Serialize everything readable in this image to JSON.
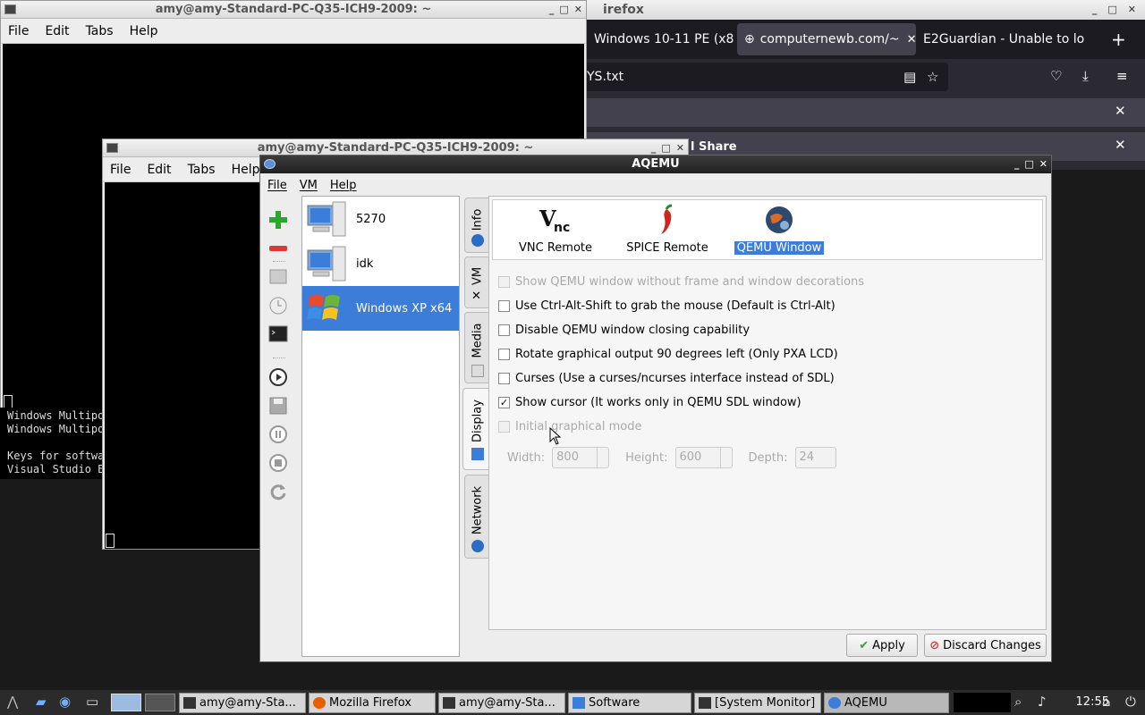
{
  "term1": {
    "title": "amy@amy-Standard-PC-Q35-ICH9-2009: ~",
    "menu": [
      "File",
      "Edit",
      "Tabs",
      "Help"
    ]
  },
  "bg_text": "Windows Multipo\nWindows Multipo\n\nKeys for softwa\nVisual Studio E",
  "firefox": {
    "title": "irefox",
    "tabs": [
      {
        "label": "Windows 10-11 PE (x8"
      },
      {
        "label": "computernewb.com/~"
      },
      {
        "label": "E2Guardian - Unable to lo"
      }
    ],
    "new_tab": "+",
    "url": "YS.txt",
    "share_label": "l Share"
  },
  "term2": {
    "title": "amy@amy-Standard-PC-Q35-ICH9-2009: ~",
    "menu": [
      "File",
      "Edit",
      "Tabs",
      "Help"
    ]
  },
  "aqemu": {
    "title": "AQEMU",
    "menu": [
      "File",
      "VM",
      "Help"
    ],
    "vms": [
      {
        "name": "5270"
      },
      {
        "name": "idk"
      },
      {
        "name": "Windows XP x64"
      }
    ],
    "tabs": [
      "Info",
      "VM",
      "Media",
      "Display",
      "Network"
    ],
    "modes": [
      "VNC Remote",
      "SPICE Remote",
      "QEMU Window"
    ],
    "options": [
      {
        "label": "Show QEMU window without frame and window decorations",
        "checked": false,
        "disabled": true
      },
      {
        "label": "Use Ctrl-Alt-Shift to grab the mouse (Default is Ctrl-Alt)",
        "checked": false,
        "disabled": false
      },
      {
        "label": "Disable QEMU window closing capability",
        "checked": false,
        "disabled": false
      },
      {
        "label": "Rotate graphical output 90 degrees left (Only PXA LCD)",
        "checked": false,
        "disabled": false
      },
      {
        "label": "Curses (Use a curses/ncurses interface instead of SDL)",
        "checked": false,
        "disabled": false
      },
      {
        "label": "Show cursor (It works only in QEMU SDL window)",
        "checked": true,
        "disabled": false
      },
      {
        "label": "Initial graphical mode",
        "checked": false,
        "disabled": true
      }
    ],
    "dims": {
      "width_label": "Width:",
      "width_value": "800",
      "height_label": "Height:",
      "height_value": "600",
      "depth_label": "Depth:",
      "depth_value": "24"
    },
    "apply_label": "Apply",
    "discard_label": "Discard Changes"
  },
  "taskbar": {
    "items": [
      {
        "label": "amy@amy-Sta..."
      },
      {
        "label": "Mozilla Firefox"
      },
      {
        "label": "amy@amy-Sta..."
      },
      {
        "label": "Software"
      },
      {
        "label": "[System Monitor]"
      },
      {
        "label": "AQEMU"
      }
    ],
    "clock": "12:55"
  },
  "colors": {
    "selection": "#3b7dd8",
    "firefox_bg": "#2b2a33",
    "add_green": "#2ea52e",
    "remove_red": "#d83a3a"
  }
}
